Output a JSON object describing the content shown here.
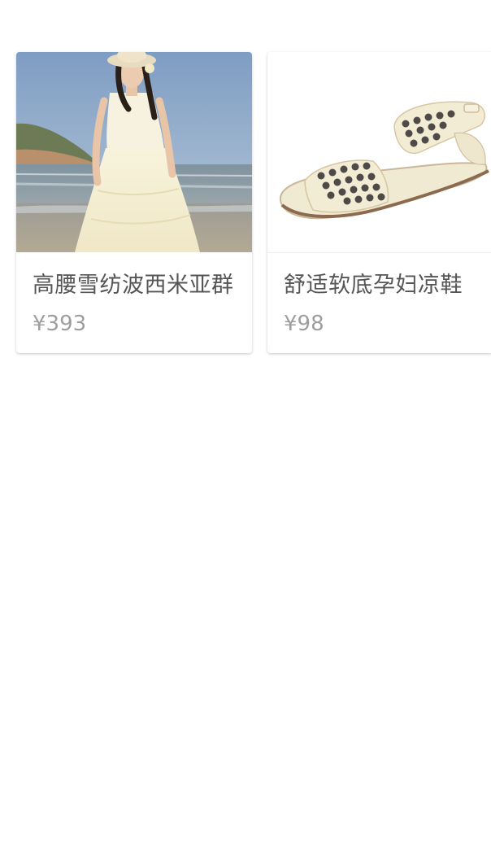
{
  "products": [
    {
      "title": "高腰雪纺波西米亚群",
      "price": "¥393",
      "image_icon": "beach-dress-photo"
    },
    {
      "title": "舒适软底孕妇凉鞋",
      "price": "¥98",
      "image_icon": "studded-sandal-photo"
    }
  ]
}
